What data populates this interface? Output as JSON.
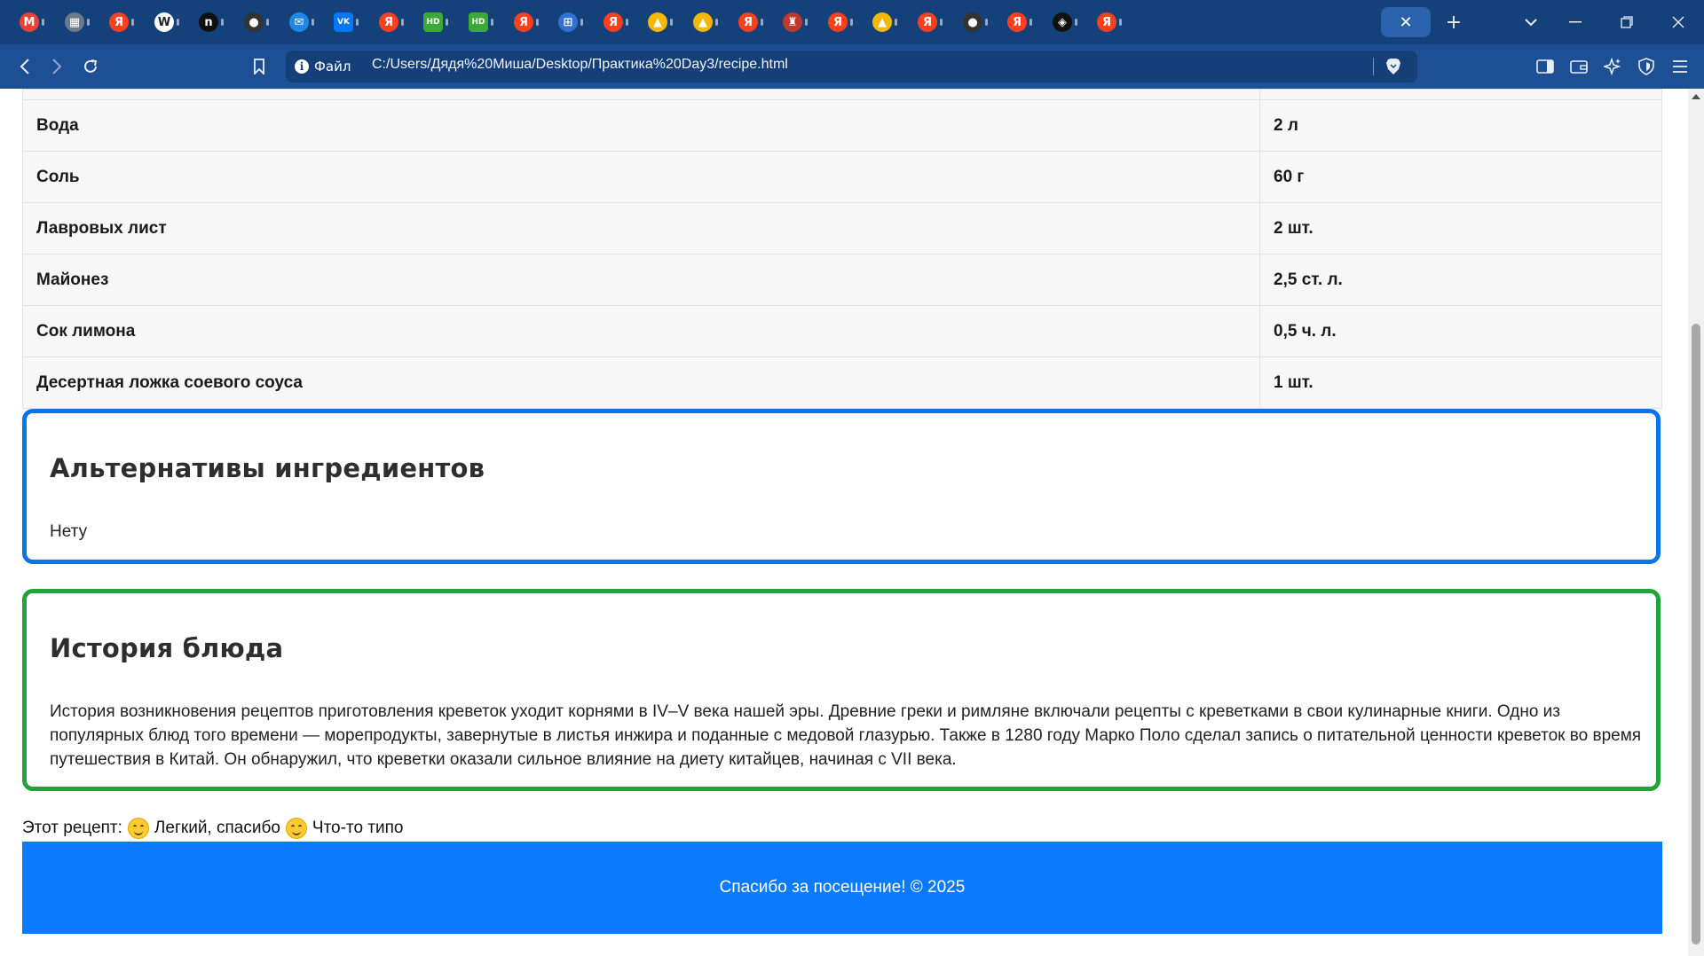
{
  "browser": {
    "tabs": [
      {
        "icon": "gmail-icon",
        "glyph": "M",
        "color": "#ea4335"
      },
      {
        "icon": "calculator-icon",
        "glyph": "▦",
        "color": "#6b7b8c"
      },
      {
        "icon": "yandex-icon",
        "glyph": "Я",
        "color": "#fc3f1d"
      },
      {
        "icon": "wikipedia-icon",
        "glyph": "W",
        "color": "#ffffff"
      },
      {
        "icon": "notion-icon",
        "glyph": "n",
        "color": "#111111"
      },
      {
        "icon": "github-icon",
        "glyph": "●",
        "color": "#333333"
      },
      {
        "icon": "chat-icon",
        "glyph": "✉",
        "color": "#1e88e5"
      },
      {
        "icon": "vk-icon",
        "glyph": "VK",
        "color": "#0077ff"
      },
      {
        "icon": "yandex-icon",
        "glyph": "Я",
        "color": "#fc3f1d"
      },
      {
        "icon": "hd-icon",
        "glyph": "HD",
        "color": "#3aa935"
      },
      {
        "icon": "hd-icon",
        "glyph": "HD",
        "color": "#3aa935"
      },
      {
        "icon": "yandex-icon",
        "glyph": "Я",
        "color": "#fc3f1d"
      },
      {
        "icon": "grid-icon",
        "glyph": "⊞",
        "color": "#2f6fd6"
      },
      {
        "icon": "yandex-icon",
        "glyph": "Я",
        "color": "#fc3f1d"
      },
      {
        "icon": "image-icon",
        "glyph": "▲",
        "color": "#f5b800"
      },
      {
        "icon": "image-icon",
        "glyph": "▲",
        "color": "#f5b800"
      },
      {
        "icon": "yandex-icon",
        "glyph": "Я",
        "color": "#fc3f1d"
      },
      {
        "icon": "game-icon",
        "glyph": "♜",
        "color": "#c0392b"
      },
      {
        "icon": "yandex-icon",
        "glyph": "Я",
        "color": "#fc3f1d"
      },
      {
        "icon": "image-icon",
        "glyph": "▲",
        "color": "#f5b800"
      },
      {
        "icon": "yandex-icon",
        "glyph": "Я",
        "color": "#fc3f1d"
      },
      {
        "icon": "github-icon",
        "glyph": "●",
        "color": "#333333"
      },
      {
        "icon": "yandex-icon",
        "glyph": "Я",
        "color": "#fc3f1d"
      },
      {
        "icon": "codepen-icon",
        "glyph": "◈",
        "color": "#111111"
      },
      {
        "icon": "yandex-icon",
        "glyph": "Я",
        "color": "#fc3f1d"
      }
    ],
    "active_tab_close": "✕",
    "new_tab": "+",
    "tab_list": "⌄",
    "site_info_label": "Файл",
    "url": "C:/Users/Дядя%20Миша/Desktop/Практика%20Day3/recipe.html"
  },
  "ingredients": [
    {
      "name": "Вода",
      "amount": "2 л"
    },
    {
      "name": "Соль",
      "amount": "60 г"
    },
    {
      "name": "Лавровых лист",
      "amount": "2 шт."
    },
    {
      "name": "Майонез",
      "amount": "2,5 ст. л."
    },
    {
      "name": "Сок лимона",
      "amount": "0,5 ч. л."
    },
    {
      "name": "Десертная ложка соевого соуса",
      "amount": "1 шт."
    }
  ],
  "alternatives": {
    "title": "Альтернативы ингредиентов",
    "text": "Нету"
  },
  "history": {
    "title": "История блюда",
    "text": "История возникновения рецептов приготовления креветок уходит корнями в IV–V века нашей эры. Древние греки и римляне включали рецепты с креветками в свои кулинарные книги. Одно из популярных блюд того времени — морепродукты, завернутые в листья инжира и поданные с медовой глазурью. Также в 1280 году Марко Поло сделал запись о питательной ценности креветок во время путешествия в Китай. Он обнаружил, что креветки оказали сильное влияние на диету китайцев, начиная с VII века."
  },
  "rating": {
    "label": "Этот рецепт:",
    "option1": "Легкий, спасибо",
    "option2": "Что-то типо"
  },
  "footer": {
    "text": "Спасибо за посещение! © 2025"
  },
  "colors": {
    "browser_tabbar": "#14417a",
    "browser_navbar": "#1d4f94",
    "alt_border": "#0b74ea",
    "history_border": "#21a23c",
    "footer_bg": "#0a7bff"
  }
}
